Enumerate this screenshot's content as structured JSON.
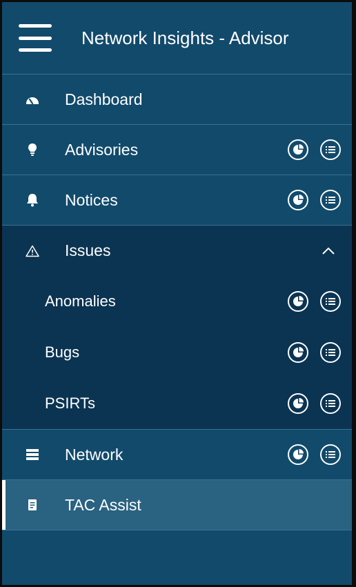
{
  "header": {
    "title": "Network Insights - Advisor"
  },
  "nav": {
    "dashboard": {
      "label": "Dashboard",
      "icon": "gauge-icon"
    },
    "advisories": {
      "label": "Advisories",
      "icon": "lightbulb-icon"
    },
    "notices": {
      "label": "Notices",
      "icon": "bell-icon"
    },
    "issues": {
      "label": "Issues",
      "icon": "warning-triangle-icon",
      "expanded": true,
      "children": {
        "anomalies": {
          "label": "Anomalies"
        },
        "bugs": {
          "label": "Bugs"
        },
        "psirts": {
          "label": "PSIRTs"
        }
      }
    },
    "network": {
      "label": "Network",
      "icon": "server-list-icon"
    },
    "tac_assist": {
      "label": "TAC Assist",
      "icon": "document-icon",
      "active": true
    }
  },
  "colors": {
    "sidebar_bg": "#124a6b",
    "submenu_bg": "#0b3452",
    "active_bg": "#2a6281",
    "divider": "#3a7193",
    "text": "#ffffff"
  }
}
